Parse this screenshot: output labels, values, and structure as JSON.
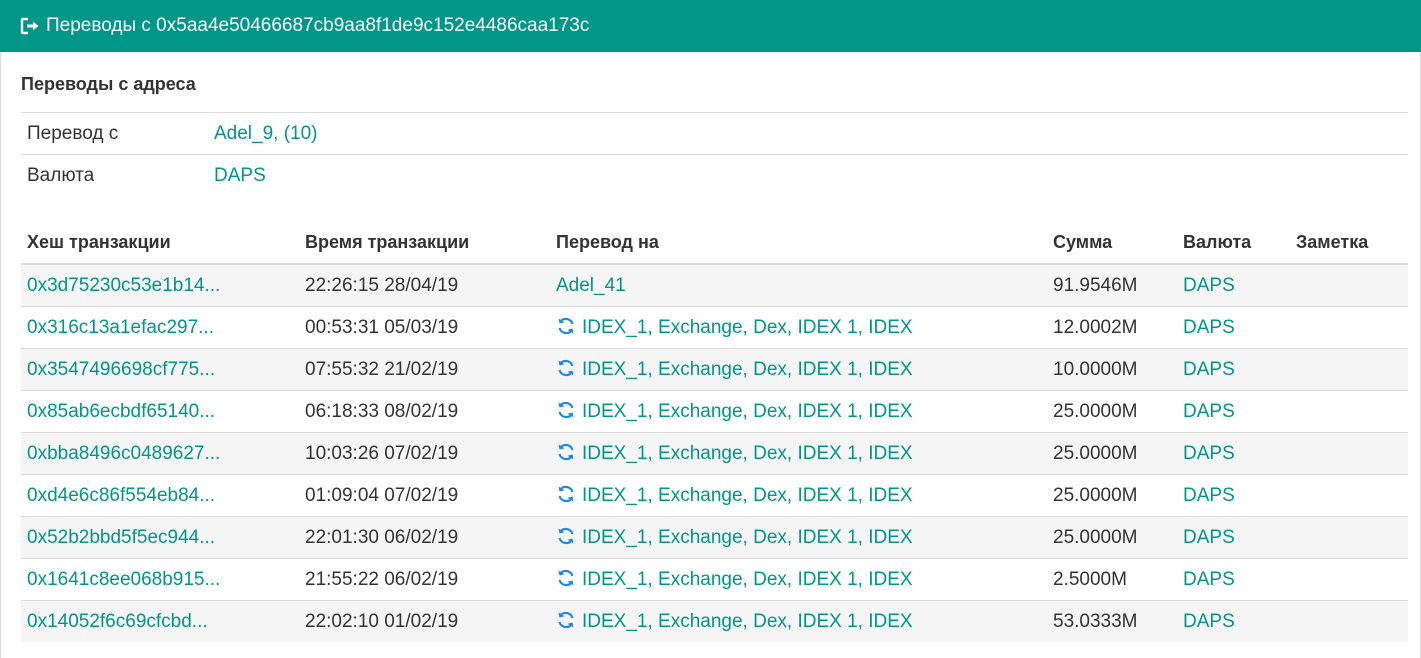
{
  "header": {
    "icon": "sign-out-icon",
    "title": "Переводы с 0x5aa4e50466687cb9aa8f1de9c152e4486caa173c"
  },
  "section": {
    "title": "Переводы с адреса"
  },
  "info": {
    "from_label": "Перевод с",
    "from_value": "Adel_9, (10)",
    "currency_label": "Валюта",
    "currency_value": "DAPS"
  },
  "table": {
    "columns": [
      "Хеш транзакции",
      "Время транзакции",
      "Перевод на",
      "Сумма",
      "Валюта",
      "Заметка"
    ],
    "rows": [
      {
        "hash": "0x3d75230c53e1b14...",
        "time": "22:26:15 28/04/19",
        "to": "Adel_41",
        "to_icon": "",
        "amount": "91.9546M",
        "currency": "DAPS",
        "note": ""
      },
      {
        "hash": "0x316c13a1efac297...",
        "time": "00:53:31 05/03/19",
        "to": "IDEX_1, Exchange, Dex, IDEX 1, IDEX",
        "to_icon": "sync-icon",
        "amount": "12.0002M",
        "currency": "DAPS",
        "note": ""
      },
      {
        "hash": "0x3547496698cf775...",
        "time": "07:55:32 21/02/19",
        "to": "IDEX_1, Exchange, Dex, IDEX 1, IDEX",
        "to_icon": "sync-icon",
        "amount": "10.0000M",
        "currency": "DAPS",
        "note": ""
      },
      {
        "hash": "0x85ab6ecbdf65140...",
        "time": "06:18:33 08/02/19",
        "to": "IDEX_1, Exchange, Dex, IDEX 1, IDEX",
        "to_icon": "sync-icon",
        "amount": "25.0000M",
        "currency": "DAPS",
        "note": ""
      },
      {
        "hash": "0xbba8496c0489627...",
        "time": "10:03:26 07/02/19",
        "to": "IDEX_1, Exchange, Dex, IDEX 1, IDEX",
        "to_icon": "sync-icon",
        "amount": "25.0000M",
        "currency": "DAPS",
        "note": ""
      },
      {
        "hash": "0xd4e6c86f554eb84...",
        "time": "01:09:04 07/02/19",
        "to": "IDEX_1, Exchange, Dex, IDEX 1, IDEX",
        "to_icon": "sync-icon",
        "amount": "25.0000M",
        "currency": "DAPS",
        "note": ""
      },
      {
        "hash": "0x52b2bbd5f5ec944...",
        "time": "22:01:30 06/02/19",
        "to": "IDEX_1, Exchange, Dex, IDEX 1, IDEX",
        "to_icon": "sync-icon",
        "amount": "25.0000M",
        "currency": "DAPS",
        "note": ""
      },
      {
        "hash": "0x1641c8ee068b915...",
        "time": "21:55:22 06/02/19",
        "to": "IDEX_1, Exchange, Dex, IDEX 1, IDEX",
        "to_icon": "sync-icon",
        "amount": "2.5000M",
        "currency": "DAPS",
        "note": ""
      },
      {
        "hash": "0x14052f6c69cfcbd...",
        "time": "22:02:10 01/02/19",
        "to": "IDEX_1, Exchange, Dex, IDEX 1, IDEX",
        "to_icon": "sync-icon",
        "amount": "53.0333M",
        "currency": "DAPS",
        "note": ""
      }
    ]
  },
  "colors": {
    "accent": "#009688",
    "stripe": "#f5f5f5",
    "border": "#dddddd",
    "sync_icon": "#1e88e5"
  }
}
